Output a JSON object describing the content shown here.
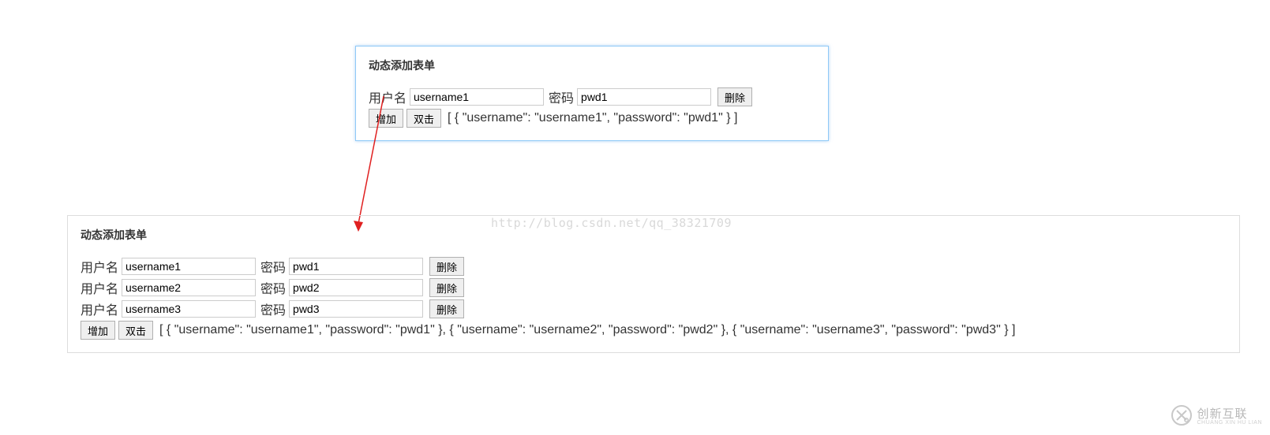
{
  "watermark": "http://blog.csdn.net/qq_38321709",
  "brand": {
    "label": "创新互联",
    "sub": "CHUANG XIN HU LIAN"
  },
  "labels": {
    "username": "用户名",
    "password": "密码",
    "delete": "删除",
    "add": "增加",
    "dblclick": "双击"
  },
  "panel_top": {
    "title": "动态添加表单",
    "rows": [
      {
        "username": "username1",
        "password": "pwd1"
      }
    ],
    "json_display": "[ { \"username\": \"username1\", \"password\": \"pwd1\" } ]"
  },
  "panel_bottom": {
    "title": "动态添加表单",
    "rows": [
      {
        "username": "username1",
        "password": "pwd1"
      },
      {
        "username": "username2",
        "password": "pwd2"
      },
      {
        "username": "username3",
        "password": "pwd3"
      }
    ],
    "json_display": "[ { \"username\": \"username1\", \"password\": \"pwd1\" }, { \"username\": \"username2\", \"password\": \"pwd2\" }, { \"username\": \"username3\", \"password\": \"pwd3\" } ]"
  }
}
